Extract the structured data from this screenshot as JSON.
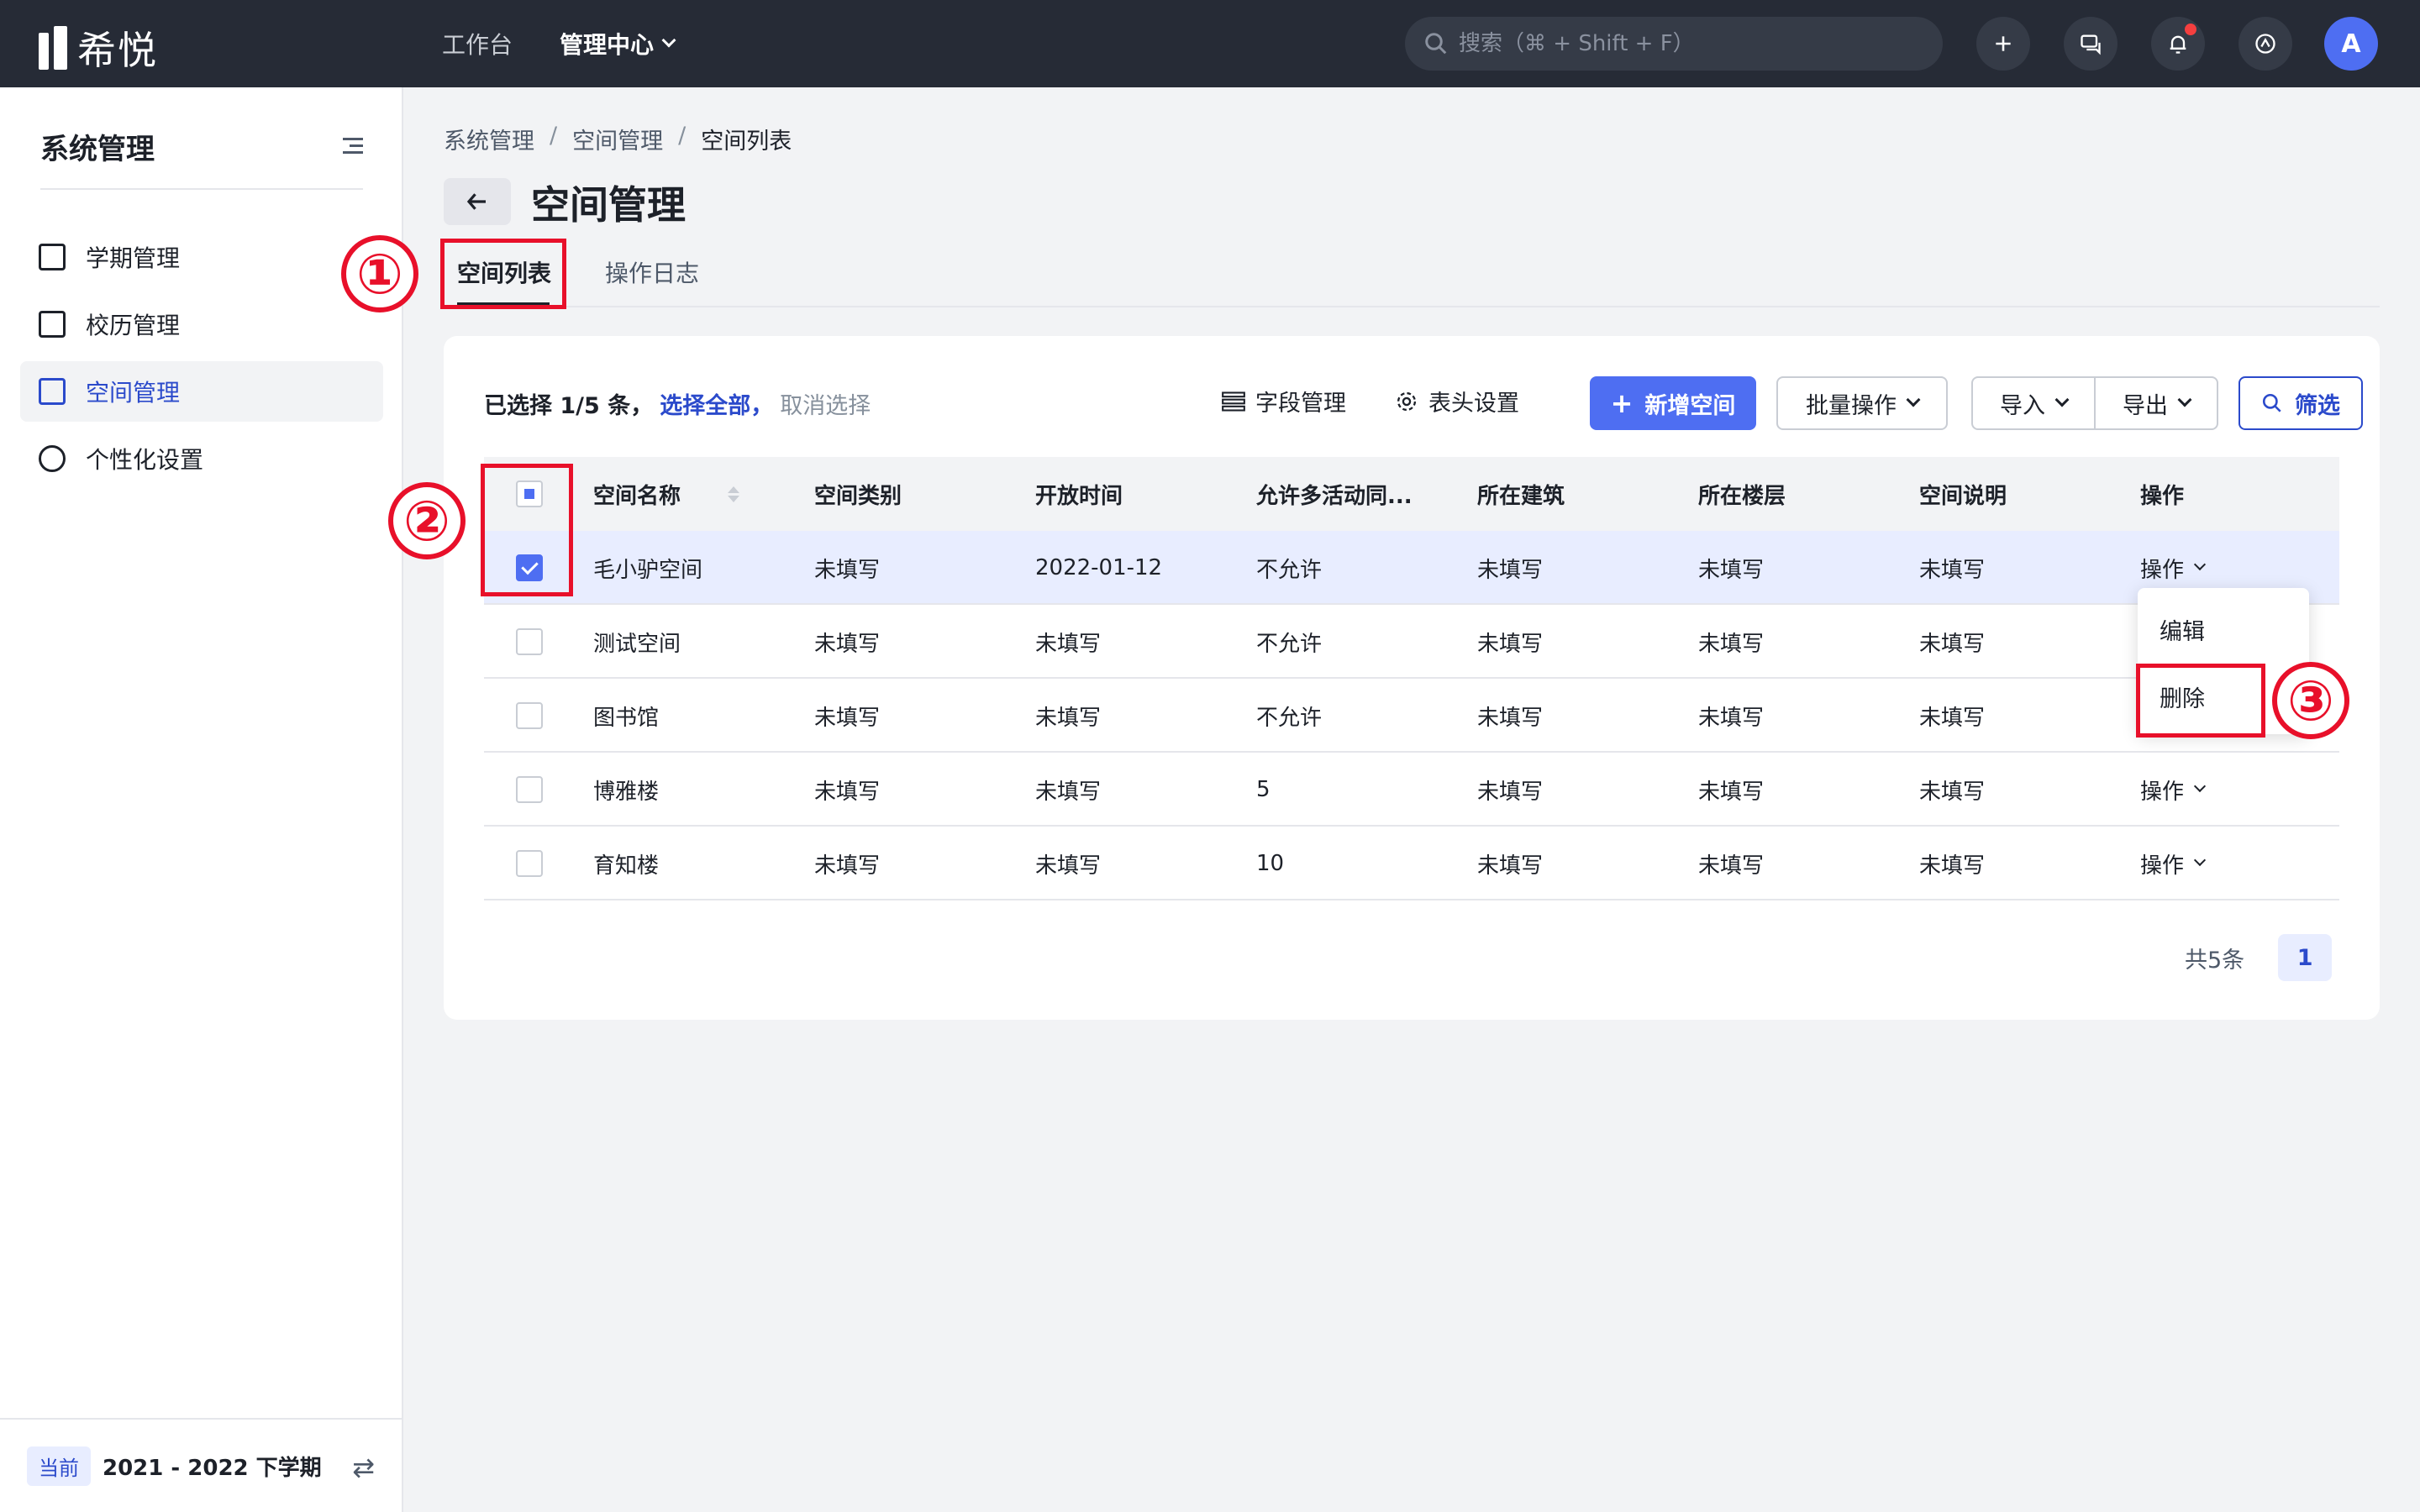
{
  "app": {
    "name": "希悦"
  },
  "topnav": {
    "items": [
      {
        "label": "工作台"
      },
      {
        "label": "管理中心"
      }
    ]
  },
  "search": {
    "placeholder": "搜索（⌘ + Shift + F）"
  },
  "user": {
    "avatar_letter": "A"
  },
  "icons": {
    "add": "plus-icon",
    "message": "message-icon",
    "notification": "bell-icon",
    "apps": "app-switch-icon"
  },
  "sidebar": {
    "title": "系统管理",
    "items": [
      {
        "label": "学期管理",
        "icon": "calendar-icon"
      },
      {
        "label": "校历管理",
        "icon": "grid-calendar-icon"
      },
      {
        "label": "空间管理",
        "icon": "cube-icon",
        "active": true
      },
      {
        "label": "个性化设置",
        "icon": "wrench-icon"
      }
    ],
    "footer": {
      "badge": "当前",
      "term": "2021 - 2022 下学期"
    }
  },
  "breadcrumb": [
    "系统管理",
    "空间管理",
    "空间列表"
  ],
  "page": {
    "title": "空间管理"
  },
  "tabs": [
    {
      "label": "空间列表",
      "active": true
    },
    {
      "label": "操作日志"
    }
  ],
  "annotations": [
    "①",
    "②",
    "③"
  ],
  "toolbar": {
    "selection_text": "已选择 1/5 条，",
    "select_all": "选择全部，",
    "cancel": "取消选择",
    "field_manage": "字段管理",
    "header_settings": "表头设置",
    "add_space": "新增空间",
    "batch_ops": "批量操作",
    "import": "导入",
    "export": "导出",
    "filter": "筛选"
  },
  "table": {
    "columns": [
      "空间名称",
      "空间类别",
      "开放时间",
      "允许多活动同...",
      "所在建筑",
      "所在楼层",
      "空间说明",
      "操作"
    ],
    "rows": [
      {
        "cells": [
          "毛小驴空间",
          "未填写",
          "2022-01-12",
          "不允许",
          "未填写",
          "未填写",
          "未填写",
          "操作"
        ],
        "checked": true
      },
      {
        "cells": [
          "测试空间",
          "未填写",
          "未填写",
          "不允许",
          "未填写",
          "未填写",
          "未填写",
          ""
        ],
        "checked": false
      },
      {
        "cells": [
          "图书馆",
          "未填写",
          "未填写",
          "不允许",
          "未填写",
          "未填写",
          "未填写",
          ""
        ],
        "checked": false
      },
      {
        "cells": [
          "博雅楼",
          "未填写",
          "未填写",
          "5",
          "未填写",
          "未填写",
          "未填写",
          "操作"
        ],
        "checked": false
      },
      {
        "cells": [
          "育知楼",
          "未填写",
          "未填写",
          "10",
          "未填写",
          "未填写",
          "未填写",
          "操作"
        ],
        "checked": false
      }
    ]
  },
  "dropdown": {
    "items": [
      "编辑",
      "删除"
    ]
  },
  "pagination": {
    "total": "共5条",
    "current": "1"
  },
  "colors": {
    "accent": "#4e6ef2",
    "annotation": "#e8102a",
    "topbar": "#262b36"
  }
}
